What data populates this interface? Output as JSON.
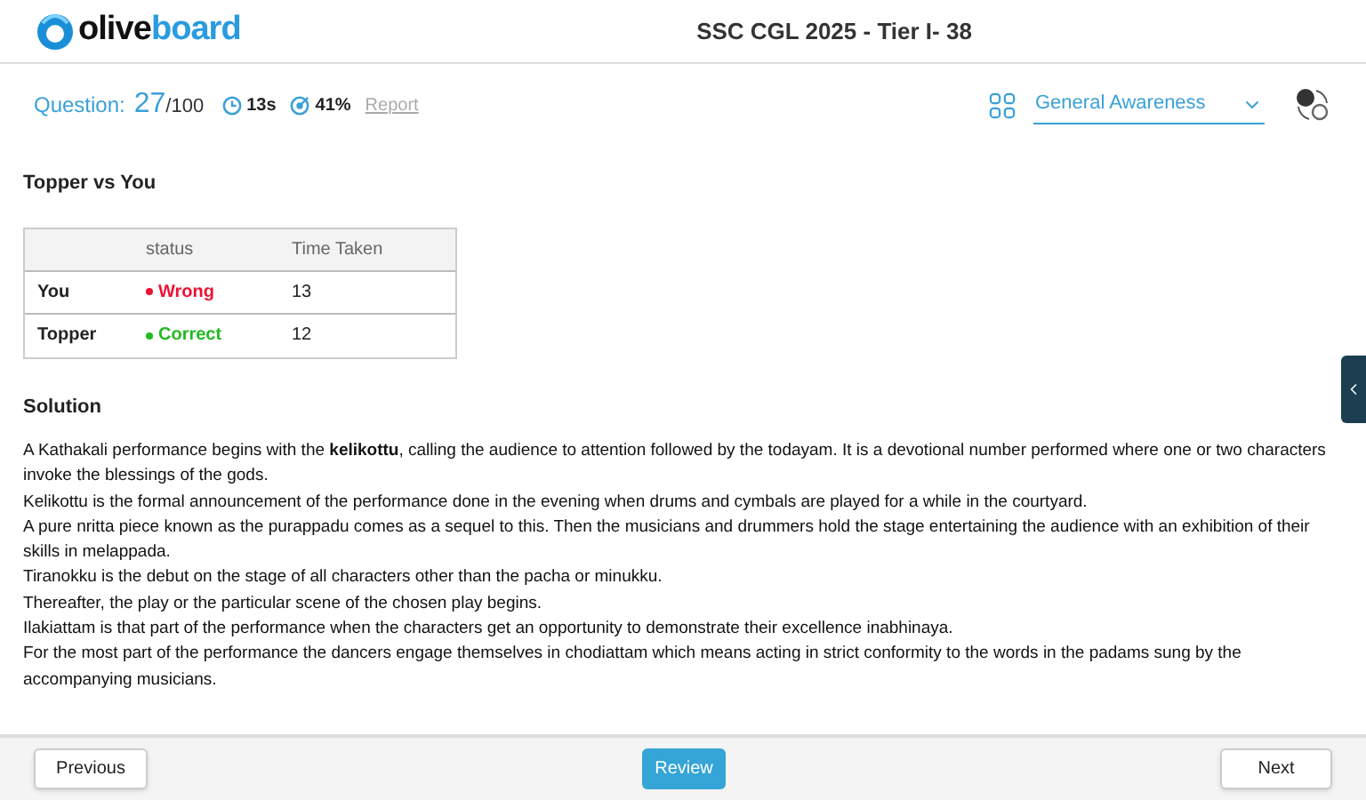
{
  "logo": [
    "olive",
    "board"
  ],
  "window": {
    "title": "SSC CGL 2025 - Tier I- 38"
  },
  "question": {
    "label": "Question:",
    "number": "27",
    "total": "/100",
    "time": "13s",
    "accuracy": "41%",
    "report": "Report"
  },
  "section_select": {
    "value": "General Awareness"
  },
  "comparison": {
    "title": "Topper vs You",
    "columns": [
      "status",
      "Time Taken"
    ],
    "rows": [
      {
        "name": "You",
        "status": "Wrong",
        "color": "#ee1133",
        "time": "13"
      },
      {
        "name": "Topper",
        "status": "Correct",
        "color": "#22bb22",
        "time": "12"
      }
    ]
  },
  "solution": {
    "title": "Solution",
    "paragraphs": [
      "A Kathakali performance begins with the **kelikottu**, calling the audience to attention followed by the todayam. It is a devotional number performed where one or two characters invoke the blessings of the gods.",
      "Kelikottu is the formal announcement of the performance done in the evening when drums and cymbals are played for a while in the courtyard.",
      "A pure nritta piece known as the purappadu comes as a sequel to this. Then the musicians and drummers hold the stage entertaining the audience with an exhibition of their skills in melappada.",
      "Tiranokku is the debut on the stage of all characters other than the pacha or minukku.",
      "Thereafter, the play or the particular scene of the chosen play begins.",
      "Ilakiattam is that part of the performance when the characters get an opportunity to demonstrate their excellence inabhinaya.",
      "For the most part of the performance the dancers engage themselves in chodiattam which means acting in strict conformity to the words in the padams sung by the accompanying musicians."
    ]
  },
  "footer": {
    "previous": "Previous",
    "review": "Review",
    "next": "Next"
  }
}
